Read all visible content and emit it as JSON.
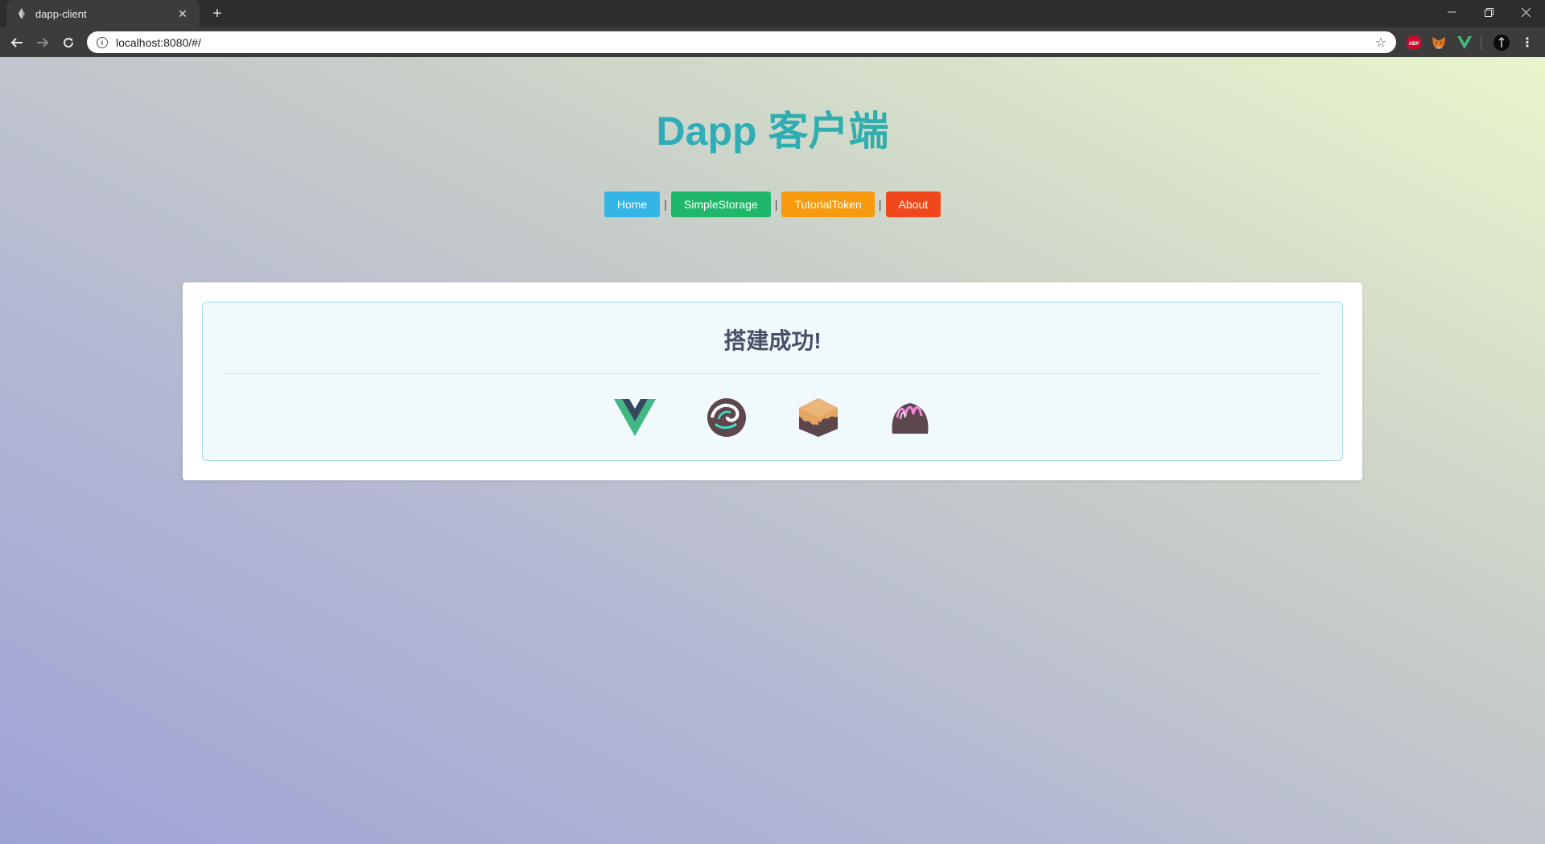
{
  "browser": {
    "tab_title": "dapp-client",
    "url": "localhost:8080/#/",
    "new_tab_symbol": "+",
    "tab_close_symbol": "✕",
    "extensions": [
      "abp-icon",
      "metamask-fox-icon",
      "vue-devtools-icon",
      "profile-avatar-icon"
    ]
  },
  "page": {
    "title": "Dapp 客户端",
    "nav": {
      "items": [
        {
          "label": "Home",
          "color": "#33b5e5"
        },
        {
          "label": "SimpleStorage",
          "color": "#1fb86a"
        },
        {
          "label": "TutorialToken",
          "color": "#f79a0e"
        },
        {
          "label": "About",
          "color": "#f0481c"
        }
      ],
      "separator": "|"
    },
    "panel": {
      "heading": "搭建成功!",
      "icons": [
        "vue-logo-icon",
        "truffle-chocolate-icon",
        "ganache-cake-icon",
        "drizzle-chocolate-icon"
      ]
    }
  }
}
